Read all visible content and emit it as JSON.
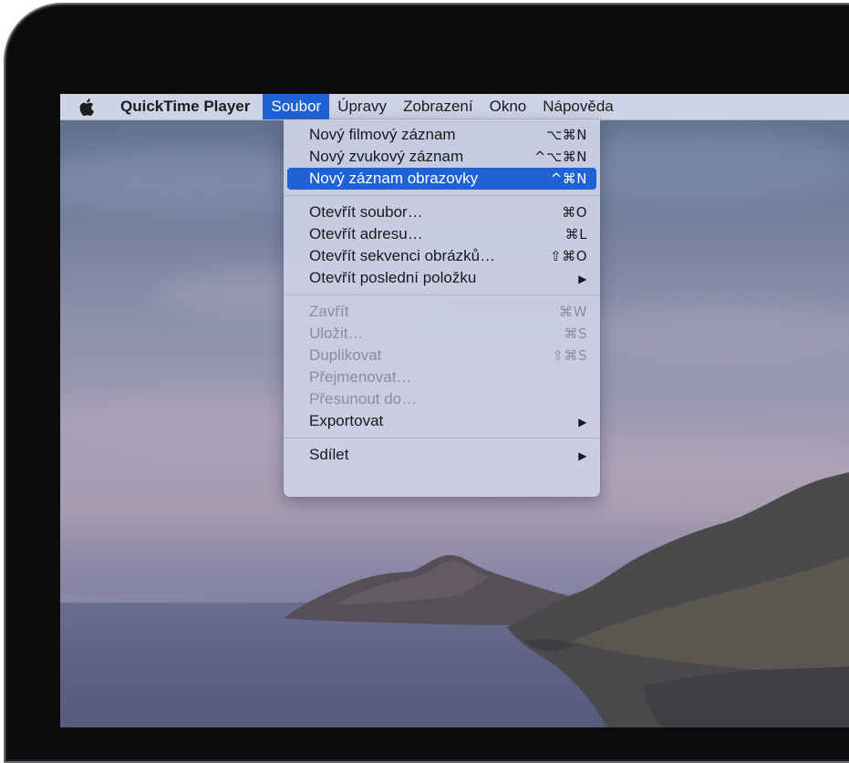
{
  "menubar": {
    "app_name": "QuickTime Player",
    "items": [
      {
        "label": "Soubor",
        "active": true
      },
      {
        "label": "Úpravy"
      },
      {
        "label": "Zobrazení"
      },
      {
        "label": "Okno"
      },
      {
        "label": "Nápověda"
      }
    ]
  },
  "menu": {
    "groups": [
      [
        {
          "label": "Nový filmový záznam",
          "shortcut": "⌥⌘N"
        },
        {
          "label": "Nový zvukový záznam",
          "shortcut": "^⌥⌘N"
        },
        {
          "label": "Nový záznam obrazovky",
          "shortcut": "^⌘N",
          "highlighted": true
        }
      ],
      [
        {
          "label": "Otevřít soubor…",
          "shortcut": "⌘O"
        },
        {
          "label": "Otevřít adresu…",
          "shortcut": "⌘L"
        },
        {
          "label": "Otevřít sekvenci obrázků…",
          "shortcut": "⇧⌘O"
        },
        {
          "label": "Otevřít poslední položku",
          "shortcut": "▶"
        }
      ],
      [
        {
          "label": "Zavřít",
          "shortcut": "⌘W",
          "disabled": true
        },
        {
          "label": "Uložit…",
          "shortcut": "⌘S",
          "disabled": true
        },
        {
          "label": "Duplikovat",
          "shortcut": "⇧⌘S",
          "disabled": true
        },
        {
          "label": "Přejmenovat…",
          "shortcut": "",
          "disabled": true
        },
        {
          "label": "Přesunout do…",
          "shortcut": "",
          "disabled": true
        },
        {
          "label": "Exportovat",
          "shortcut": "▶"
        }
      ],
      [
        {
          "label": "Sdílet",
          "shortcut": "▶"
        }
      ]
    ]
  },
  "colors": {
    "highlight": "#1f62d6",
    "menubar": "#d6daec",
    "disabled_text": "#8a8ca1"
  }
}
